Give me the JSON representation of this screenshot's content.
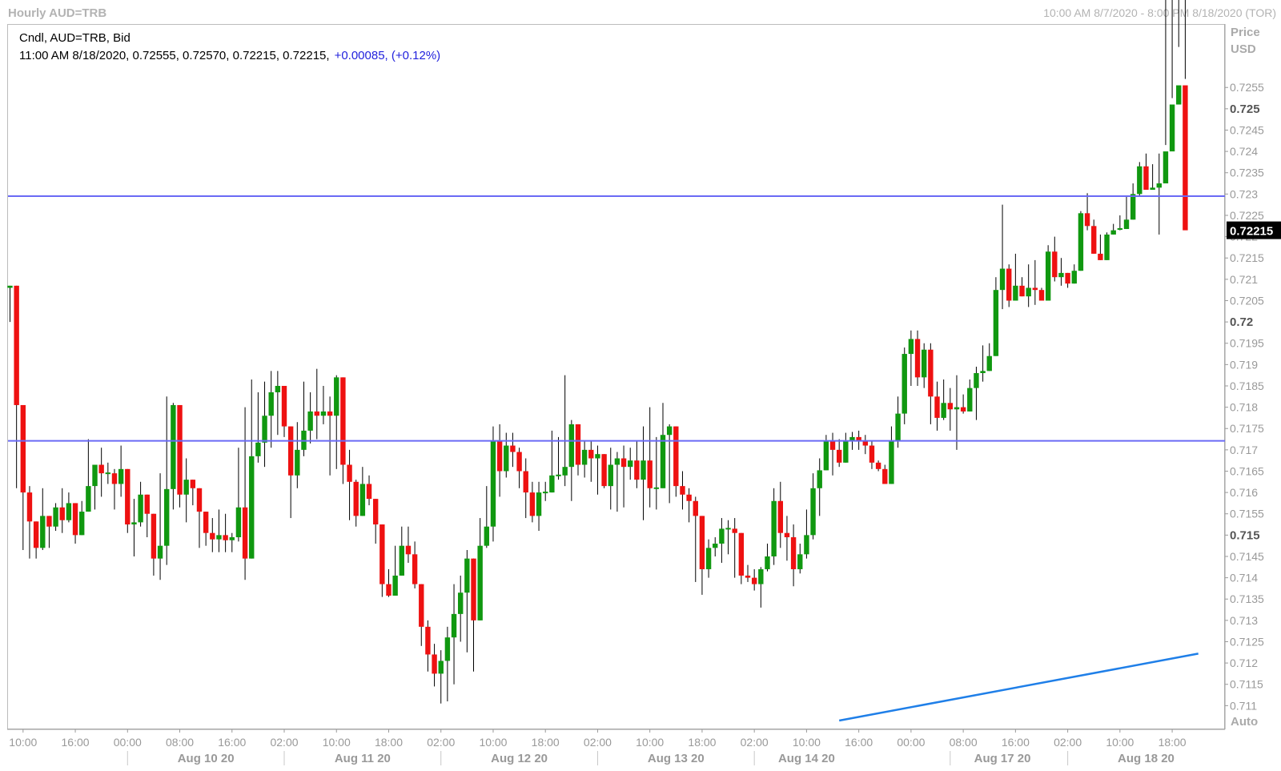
{
  "header": {
    "title": "Hourly AUD=TRB",
    "range": "10:00 AM 8/7/2020 - 8:00 PM 8/18/2020 (TOR)"
  },
  "legend": {
    "line1": "Cndl, AUD=TRB, Bid",
    "ohlc": "11:00 AM 8/18/2020, 0.72555, 0.72570, 0.72215, 0.72215,",
    "change": "+0.00085, (+0.12%)"
  },
  "axis": {
    "price_label": "Price",
    "currency_label": "USD",
    "auto_label": "Auto",
    "last_price": "0.72215"
  },
  "colors": {
    "up": "#109810",
    "down": "#ee1111",
    "hline": "#6a6af5",
    "trend": "#1f7fe8",
    "price_tag_bg": "#000000"
  },
  "chart_data": {
    "type": "candlestick",
    "series_name": "AUD=TRB",
    "ylim": [
      0.71065,
      0.72665
    ],
    "y_ticks": [
      "0.7255",
      "0.725",
      "0.7245",
      "0.724",
      "0.7235",
      "0.723",
      "0.7225",
      "0.722",
      "0.7215",
      "0.721",
      "0.7205",
      "0.72",
      "0.7195",
      "0.719",
      "0.7185",
      "0.718",
      "0.7175",
      "0.717",
      "0.7165",
      "0.716",
      "0.7155",
      "0.715",
      "0.7145",
      "0.714",
      "0.7135",
      "0.713",
      "0.7125",
      "0.712",
      "0.7115",
      "0.711"
    ],
    "y_ticks_major": [
      "0.725",
      "0.72",
      "0.715"
    ],
    "x_time_labels": [
      "10:00",
      "16:00",
      "00:00",
      "08:00",
      "16:00",
      "02:00",
      "10:00",
      "18:00",
      "02:00",
      "10:00",
      "18:00",
      "02:00",
      "10:00",
      "18:00",
      "02:00",
      "10:00",
      "16:00",
      "00:00",
      "08:00",
      "16:00",
      "02:00",
      "10:00",
      "18:00"
    ],
    "x_date_labels": [
      "Aug 10 20",
      "Aug 11 20",
      "Aug 12 20",
      "Aug 13 20",
      "Aug 14 20",
      "Aug 17 20",
      "Aug 18 20"
    ],
    "horizontal_lines": [
      0.72295,
      0.71721
    ],
    "trendline": [
      {
        "bar": 127,
        "price": 0.71065
      },
      {
        "bar": 182,
        "price": 0.71222
      }
    ],
    "closes": [
      0.72085,
      0.71805,
      0.716,
      0.71532,
      0.7147,
      0.71545,
      0.7152,
      0.71565,
      0.71535,
      0.71575,
      0.715,
      0.71555,
      0.71615,
      0.71665,
      0.71645,
      0.71645,
      0.7162,
      0.71655,
      0.71525,
      0.7153,
      0.71595,
      0.7155,
      0.71445,
      0.71475,
      0.71608,
      0.71805,
      0.71595,
      0.7163,
      0.7161,
      0.71555,
      0.71505,
      0.7149,
      0.715,
      0.71488,
      0.71495,
      0.71565,
      0.71445,
      0.71685,
      0.71717,
      0.7178,
      0.71835,
      0.7185,
      0.71755,
      0.7164,
      0.717,
      0.71745,
      0.7179,
      0.7178,
      0.7179,
      0.7178,
      0.7187,
      0.71665,
      0.71625,
      0.71545,
      0.7162,
      0.71585,
      0.71525,
      0.71385,
      0.71358,
      0.71405,
      0.71475,
      0.71455,
      0.71385,
      0.71285,
      0.7122,
      0.71175,
      0.71205,
      0.7126,
      0.71315,
      0.71365,
      0.71445,
      0.713,
      0.71475,
      0.7152,
      0.7172,
      0.7165,
      0.7171,
      0.71695,
      0.7165,
      0.716,
      0.71545,
      0.716,
      0.716,
      0.7164,
      0.7164,
      0.7166,
      0.7176,
      0.71665,
      0.717,
      0.7168,
      0.7169,
      0.71615,
      0.71665,
      0.7168,
      0.7166,
      0.71675,
      0.7163,
      0.71675,
      0.7161,
      0.7161,
      0.71735,
      0.71755,
      0.71615,
      0.71595,
      0.7158,
      0.71545,
      0.7142,
      0.7147,
      0.7148,
      0.71515,
      0.71515,
      0.71505,
      0.71405,
      0.714,
      0.71385,
      0.7142,
      0.7145,
      0.7158,
      0.71505,
      0.71495,
      0.7142,
      0.71455,
      0.715,
      0.7161,
      0.71652,
      0.71722,
      0.717,
      0.7167,
      0.7172,
      0.7173,
      0.7172,
      0.7171,
      0.7167,
      0.71655,
      0.7162,
      0.7172,
      0.71785,
      0.71925,
      0.7196,
      0.7187,
      0.71935,
      0.71825,
      0.71775,
      0.7181,
      0.71795,
      0.718,
      0.7179,
      0.71845,
      0.7188,
      0.71885,
      0.7192,
      0.72075,
      0.72125,
      0.7205,
      0.72085,
      0.7206,
      0.7208,
      0.72075,
      0.7205,
      0.72165,
      0.72105,
      0.72115,
      0.7209,
      0.7212,
      0.72255,
      0.72225,
      0.7216,
      0.72145,
      0.72205,
      0.72215,
      0.72218,
      0.7224,
      0.723,
      0.72365,
      0.7231,
      0.72315,
      0.72325,
      0.724,
      0.7251,
      0.72555,
      0.72215
    ],
    "high_raw": [
      0.7208,
      0.71845,
      0.71795,
      0.71615,
      0.7153,
      0.7161,
      0.71535,
      0.71575,
      0.7161,
      0.716,
      0.71535,
      0.7158,
      0.71725,
      0.7166,
      0.71705,
      0.7167,
      0.71655,
      0.7171,
      0.71605,
      0.71585,
      0.71625,
      0.7159,
      0.7152,
      0.71645,
      0.71825,
      0.7181,
      0.71645,
      0.7168,
      0.7163,
      0.7158,
      0.7151,
      0.7154,
      0.7156,
      0.7155,
      0.71505,
      0.71705,
      0.718,
      0.71865,
      0.71835,
      0.7186,
      0.71885,
      0.71885,
      0.7184,
      0.71755,
      0.71765,
      0.7186,
      0.71835,
      0.7189,
      0.7185,
      0.71825,
      0.71875,
      0.7172,
      0.717,
      0.7163,
      0.7166,
      0.7164,
      0.71585,
      0.71455,
      0.7142,
      0.71475,
      0.7152,
      0.7152,
      0.71485,
      0.71375,
      0.713,
      0.71245,
      0.7123,
      0.71285,
      0.71385,
      0.71405,
      0.71465,
      0.71395,
      0.7154,
      0.71615,
      0.71755,
      0.7176,
      0.7174,
      0.7174,
      0.71705,
      0.7168,
      0.71625,
      0.71625,
      0.71625,
      0.71745,
      0.7173,
      0.71875,
      0.7177,
      0.71725,
      0.7172,
      0.7172,
      0.7171,
      0.7169,
      0.71705,
      0.71695,
      0.7171,
      0.71705,
      0.7172,
      0.71755,
      0.718,
      0.7173,
      0.7181,
      0.7176,
      0.7174,
      0.7165,
      0.7161,
      0.7159,
      0.7154,
      0.7149,
      0.71495,
      0.7154,
      0.71535,
      0.7154,
      0.71495,
      0.7143,
      0.7142,
      0.71425,
      0.7148,
      0.7161,
      0.71625,
      0.71545,
      0.71525,
      0.7148,
      0.7156,
      0.71645,
      0.7168,
      0.71735,
      0.7174,
      0.71725,
      0.7174,
      0.71742,
      0.71745,
      0.71735,
      0.7172,
      0.71675,
      0.71665,
      0.71755,
      0.71825,
      0.7194,
      0.7198,
      0.7198,
      0.7195,
      0.7195,
      0.7186,
      0.71865,
      0.71845,
      0.71875,
      0.7183,
      0.71865,
      0.71895,
      0.71945,
      0.7195,
      0.72105,
      0.72275,
      0.72135,
      0.7216,
      0.72105,
      0.72135,
      0.72145,
      0.7208,
      0.7218,
      0.722,
      0.7215,
      0.7211,
      0.72135,
      0.7226,
      0.72302,
      0.7224,
      0.72205,
      0.7221,
      0.7223,
      0.7225,
      0.72295,
      0.72325,
      0.72375,
      0.72395,
      0.7237,
      0.72395,
      0.72415,
      0.72525,
      0.72645,
      0.7257
    ],
    "low_raw": [
      0.72,
      0.7161,
      0.71465,
      0.71445,
      0.71445,
      0.71465,
      0.7147,
      0.7151,
      0.71505,
      0.7153,
      0.7148,
      0.7152,
      0.71555,
      0.7156,
      0.7159,
      0.7162,
      0.7156,
      0.7159,
      0.71505,
      0.7145,
      0.7152,
      0.71495,
      0.71405,
      0.71395,
      0.7143,
      0.7156,
      0.71565,
      0.7153,
      0.7157,
      0.7147,
      0.71475,
      0.7146,
      0.7146,
      0.7146,
      0.7146,
      0.71485,
      0.71395,
      0.71565,
      0.7167,
      0.7166,
      0.71705,
      0.71735,
      0.7173,
      0.7154,
      0.7161,
      0.71685,
      0.71715,
      0.71725,
      0.7176,
      0.7164,
      0.71655,
      0.7162,
      0.71535,
      0.7152,
      0.7156,
      0.7157,
      0.7148,
      0.71355,
      0.71355,
      0.7136,
      0.71405,
      0.71435,
      0.71375,
      0.7124,
      0.7118,
      0.71145,
      0.71105,
      0.7111,
      0.7115,
      0.7125,
      0.71225,
      0.7118,
      0.7133,
      0.7147,
      0.71485,
      0.7159,
      0.71635,
      0.7166,
      0.7161,
      0.7154,
      0.7153,
      0.7151,
      0.7158,
      0.716,
      0.7163,
      0.71615,
      0.7158,
      0.7164,
      0.71635,
      0.71625,
      0.71595,
      0.7161,
      0.7156,
      0.71555,
      0.71565,
      0.7163,
      0.7161,
      0.71535,
      0.71565,
      0.7156,
      0.71665,
      0.71575,
      0.7159,
      0.7156,
      0.7153,
      0.7139,
      0.7136,
      0.714,
      0.7145,
      0.71435,
      0.71455,
      0.714,
      0.71385,
      0.7139,
      0.7137,
      0.7133,
      0.71415,
      0.7143,
      0.7147,
      0.7144,
      0.7138,
      0.7141,
      0.71445,
      0.7149,
      0.71545,
      0.7166,
      0.7164,
      0.7166,
      0.7168,
      0.717,
      0.717,
      0.7169,
      0.71655,
      0.7165,
      0.7162,
      0.7162,
      0.71705,
      0.7176,
      0.7185,
      0.7185,
      0.71845,
      0.7176,
      0.71745,
      0.7177,
      0.71745,
      0.717,
      0.71785,
      0.71795,
      0.7177,
      0.7186,
      0.7191,
      0.72025,
      0.7203,
      0.72035,
      0.7205,
      0.7206,
      0.72035,
      0.7204,
      0.7206,
      0.721,
      0.72095,
      0.72085,
      0.7208,
      0.7212,
      0.7221,
      0.72215,
      0.72165,
      0.7221,
      0.72215,
      0.7222,
      0.72245,
      0.72255,
      0.72265,
      0.72295,
      0.7238,
      0.72485,
      0.72205
    ]
  }
}
